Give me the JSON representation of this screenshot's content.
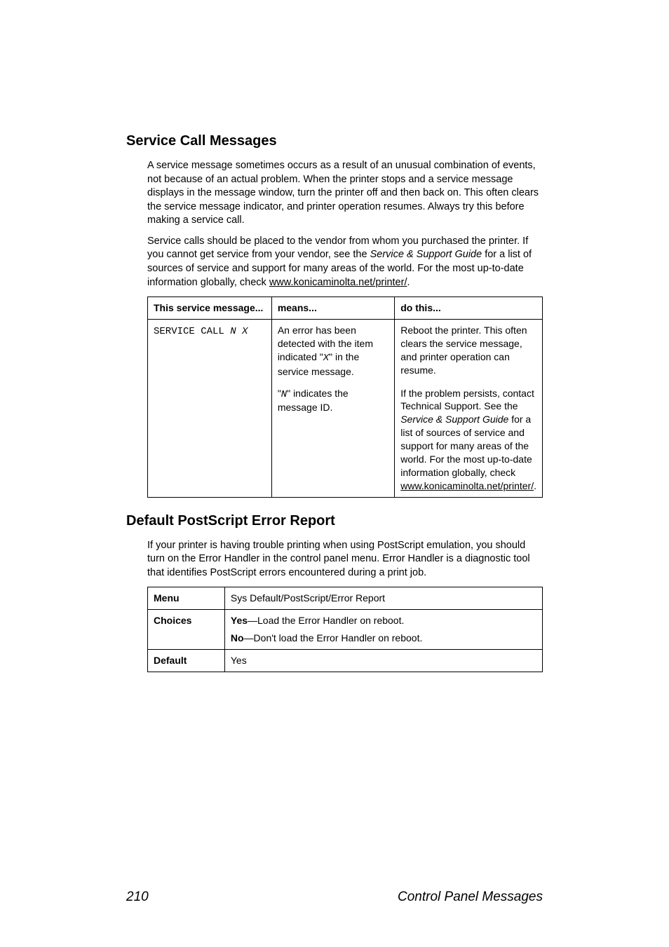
{
  "section1": {
    "title": "Service Call Messages",
    "p1": "A service message sometimes occurs as a result of an unusual combination of events, not because of an actual problem. When the printer stops and a service message displays in the message window, turn the printer off and then back on. This often clears the service message indicator, and printer operation resumes. Always try this before making a service call.",
    "p2_a": "Service calls should be placed to the vendor from whom you purchased the printer. If you cannot get service from your vendor, see the ",
    "p2_italic": "Service & Support Guide",
    "p2_b": " for a list of sources of service and support for many areas of the world. For the most up-to-date information globally, check ",
    "p2_link": "www.konicaminolta.net/printer/",
    "p2_c": "."
  },
  "svc": {
    "h1": "This service message...",
    "h2": "means...",
    "h3": "do this...",
    "r1c1_a": "SERVICE CALL ",
    "r1c1_b": "N X",
    "r1c2_a": "An error has been detected with the item indicated \"",
    "r1c2_x": "X",
    "r1c2_b": "\" in the service message.",
    "r1c3": "Reboot the printer. This often clears the service message, and printer operation can resume.",
    "r2c2_a": "\"",
    "r2c2_n": "N",
    "r2c2_b": "\" indicates the message ID.",
    "r2c3_a": "If the problem persists, contact Technical Support. See the ",
    "r2c3_italic": "Service & Support Guide",
    "r2c3_b": " for a list of sources of service and support for many areas of the world. For the most up-to-date information globally, check ",
    "r2c3_link": "www.konicaminolta.net/printer/",
    "r2c3_c": "."
  },
  "section2": {
    "title": "Default PostScript Error Report",
    "p1": "If your printer is having trouble printing when using PostScript emulation, you should turn on the Error Handler in the control panel menu. Error Handler is a diagnostic tool that identifies PostScript errors encountered during a print job."
  },
  "menu": {
    "r1a": "Menu",
    "r1b": "Sys Default/PostScript/Error Report",
    "r2a": "Choices",
    "r2b_yes_label": "Yes",
    "r2b_yes_text": "—Load the Error Handler on reboot.",
    "r2b_no_label": "No",
    "r2b_no_text": "—Don't load the Error Handler on reboot.",
    "r3a": "Default",
    "r3b": "Yes"
  },
  "footer": {
    "page": "210",
    "title": "Control Panel Messages"
  }
}
